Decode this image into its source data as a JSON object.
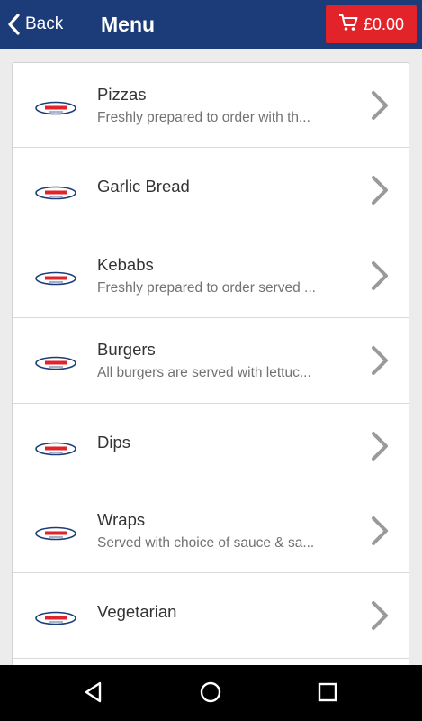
{
  "header": {
    "back_label": "Back",
    "title": "Menu",
    "cart_total": "£0.00",
    "bar_color": "#1b3c78",
    "cart_color": "#e2242a"
  },
  "menu": {
    "items": [
      {
        "name": "Pizzas",
        "description": "Freshly prepared to order with th..."
      },
      {
        "name": "Garlic Bread",
        "description": ""
      },
      {
        "name": "Kebabs",
        "description": "Freshly prepared to order served ..."
      },
      {
        "name": "Burgers",
        "description": "All burgers are served with lettuc..."
      },
      {
        "name": "Dips",
        "description": ""
      },
      {
        "name": "Wraps",
        "description": "Served with choice of sauce & sa..."
      },
      {
        "name": "Vegetarian",
        "description": ""
      }
    ]
  },
  "icons": {
    "back": "chevron-left-icon",
    "cart": "shopping-cart-icon",
    "item_logo": "restaurant-logo",
    "item_arrow": "chevron-right-icon",
    "nav_back": "triangle-back-icon",
    "nav_home": "circle-home-icon",
    "nav_recents": "square-recents-icon"
  }
}
